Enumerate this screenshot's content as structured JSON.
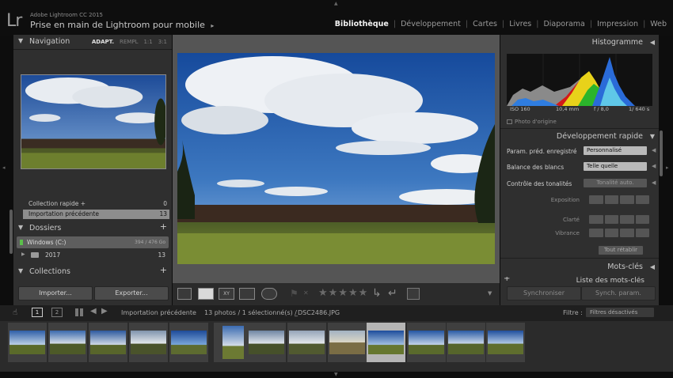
{
  "top": {
    "logo": "Lr",
    "app_name": "Adobe Lightroom CC 2015",
    "catalog_name": "Prise en main de Lightroom pour mobile",
    "catalog_arrow": "▸",
    "modules": [
      "Bibliothèque",
      "Développement",
      "Cartes",
      "Livres",
      "Diaporama",
      "Impression",
      "Web"
    ],
    "active_module": "Bibliothèque"
  },
  "left": {
    "navigator_title": "Navigation",
    "nav_options": [
      "ADAPT.",
      "REMPL",
      "1:1",
      "3:1"
    ],
    "catalog_rows": [
      {
        "label": "Collection rapide +",
        "count": "0"
      },
      {
        "label": "Importation précédente",
        "count": "13"
      }
    ],
    "folders_title": "Dossiers",
    "volume": {
      "name": "Windows (C:)",
      "space": "394 / 476 Go"
    },
    "folder": {
      "name": "2017",
      "count": "13"
    },
    "collections_title": "Collections",
    "import_label": "Importer...",
    "export_label": "Exporter..."
  },
  "right": {
    "histogram_title": "Histogramme",
    "histo_info": {
      "iso": "ISO 160",
      "focal": "10,4 mm",
      "aperture": "f / 8,0",
      "shutter": "1/ 640 s"
    },
    "original_label": "Photo d'origine",
    "quick_dev_title": "Développement rapide",
    "preset_label": "Param. préd. enregistré",
    "preset_value": "Personnalisé",
    "wb_label": "Balance des blancs",
    "wb_value": "Telle quelle",
    "tone_label": "Contrôle des tonalités",
    "auto_tone": "Tonalité auto.",
    "exposure_label": "Exposition",
    "clarity_label": "Clarté",
    "vibrance_label": "Vibrance",
    "reset_label": "Tout rétablir",
    "keywords_title": "Mots-clés",
    "keyword_list_title": "Liste des mots-clés",
    "sync_label": "Synchroniser",
    "sync_settings_label": "Synch. param."
  },
  "toolbar": {
    "stars": "★★★★★"
  },
  "filmstrip_bar": {
    "page1": "1",
    "page2": "2",
    "source": "Importation précédente",
    "status": "13 photos / 1 sélectionné(s) /",
    "filename": "_DSC2486.JPG",
    "filter_label": "Filtre :",
    "filter_value": "Filtres désactivés"
  }
}
